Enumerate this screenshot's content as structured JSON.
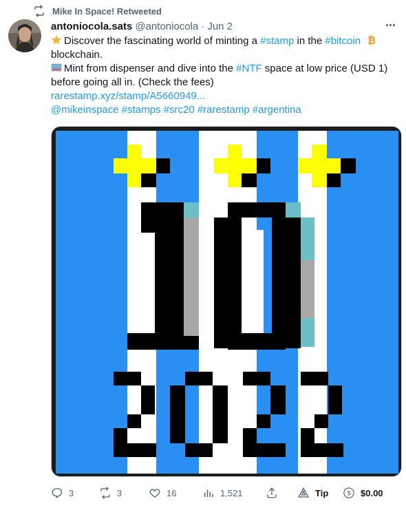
{
  "retweet": {
    "text": "Mike In Space! Retweeted"
  },
  "tweet": {
    "author_name": "antoniocola.sats",
    "author_handle": "@antoniocola",
    "separator": "·",
    "date": "Jun 2",
    "line1_pre": "Discover the fascinating world of minting a ",
    "line1_tag1": "#stamp",
    "line1_mid": " in the ",
    "line1_tag2": "#bitcoin",
    "line2": "blockchain.",
    "line3_pre": "Mint from dispenser and dive into the ",
    "line3_tag": "#NTF",
    "line3_post": " space at low price (USD 1)",
    "line4": "before going all in. (Check the fees)",
    "link": "rarestamp.xyz/stamp/A5660949...",
    "mention": "@mikeinspace",
    "tags_line": " #stamps #src20  #rarestamp #argentina"
  },
  "media": {
    "description_colors": {
      "light_blue": "#2a8ff2",
      "white": "#ffffff",
      "yellow": "#ffff00",
      "black": "#000000",
      "gray": "#a8a8a8",
      "teal": "#6cbec7"
    },
    "text_top": "10",
    "text_bottom": "2022"
  },
  "actions": {
    "reply_count": "3",
    "retweet_count": "3",
    "like_count": "16",
    "views_count": "1,521",
    "tip_label": "Tip",
    "cash_label": "$0.00"
  },
  "icons": {
    "retweet": "retweet-icon",
    "reply": "reply-icon",
    "like": "heart-icon",
    "views": "views-icon",
    "share": "share-icon",
    "tip": "tip-icon",
    "cash": "cashtag-icon",
    "more": "more-icon",
    "star": "star-emoji",
    "bitcoin": "bitcoin-icon",
    "tv": "tv-emoji"
  }
}
